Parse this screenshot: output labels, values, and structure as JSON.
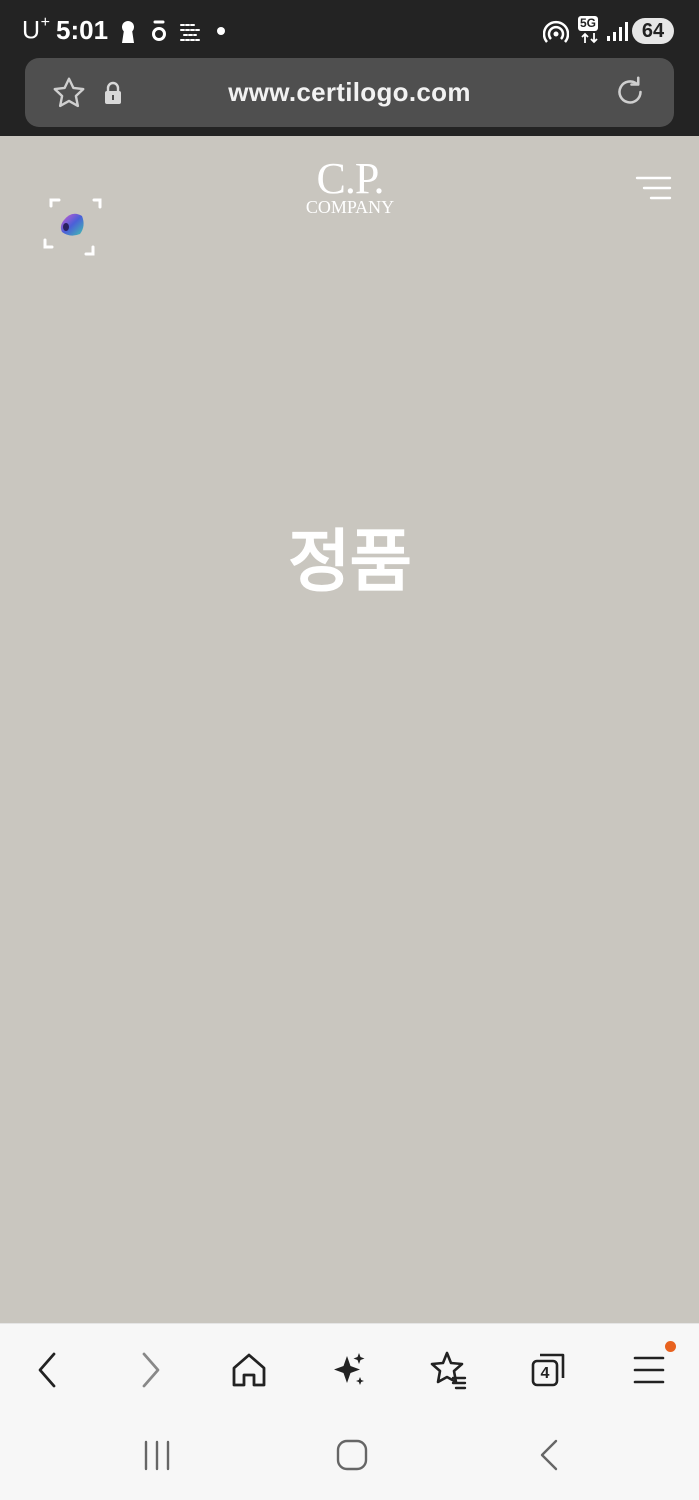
{
  "status_bar": {
    "carrier": "U",
    "carrier_sup": "+",
    "time": "5:01",
    "network": "5G",
    "battery": "64"
  },
  "browser": {
    "url": "www.certilogo.com"
  },
  "page": {
    "brand_line1": "C.P.",
    "brand_line2": "COMPANY",
    "result_text": "정품"
  },
  "toolbar": {
    "tab_count": "4"
  },
  "colors": {
    "page_background": "#c9c6bf",
    "status_bar": "#232323",
    "url_pill": "#4f4f4f",
    "notification_dot": "#e8621f"
  }
}
